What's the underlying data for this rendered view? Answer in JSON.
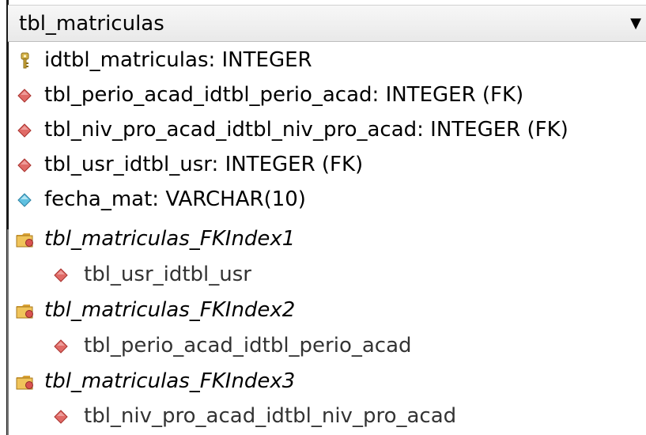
{
  "table": {
    "name": "tbl_matriculas",
    "caret": "▼"
  },
  "columns": [
    {
      "text": "idtbl_matriculas: INTEGER",
      "icon": "key-icon",
      "color": "#c9a437"
    },
    {
      "text": "tbl_perio_acad_idtbl_perio_acad: INTEGER (FK)",
      "icon": "foreign-key-diamond-icon",
      "color": "#d9534f"
    },
    {
      "text": "tbl_niv_pro_acad_idtbl_niv_pro_acad: INTEGER (FK)",
      "icon": "foreign-key-diamond-icon",
      "color": "#d9534f"
    },
    {
      "text": "tbl_usr_idtbl_usr: INTEGER (FK)",
      "icon": "foreign-key-diamond-icon",
      "color": "#d9534f"
    },
    {
      "text": "fecha_mat: VARCHAR(10)",
      "icon": "attribute-diamond-icon",
      "color": "#4fb6d8"
    }
  ],
  "indexes": [
    {
      "name": "tbl_matriculas_FKIndex1",
      "icon": "index-folder-icon",
      "columns": [
        "tbl_usr_idtbl_usr"
      ]
    },
    {
      "name": "tbl_matriculas_FKIndex2",
      "icon": "index-folder-icon",
      "columns": [
        "tbl_perio_acad_idtbl_perio_acad"
      ]
    },
    {
      "name": "tbl_matriculas_FKIndex3",
      "icon": "index-folder-icon",
      "columns": [
        "tbl_niv_pro_acad_idtbl_niv_pro_acad"
      ]
    }
  ],
  "colors": {
    "fk_diamond": "#d9534f",
    "attr_diamond": "#4fb6d8",
    "key": "#c9a437",
    "folder": "#e8b84a"
  }
}
